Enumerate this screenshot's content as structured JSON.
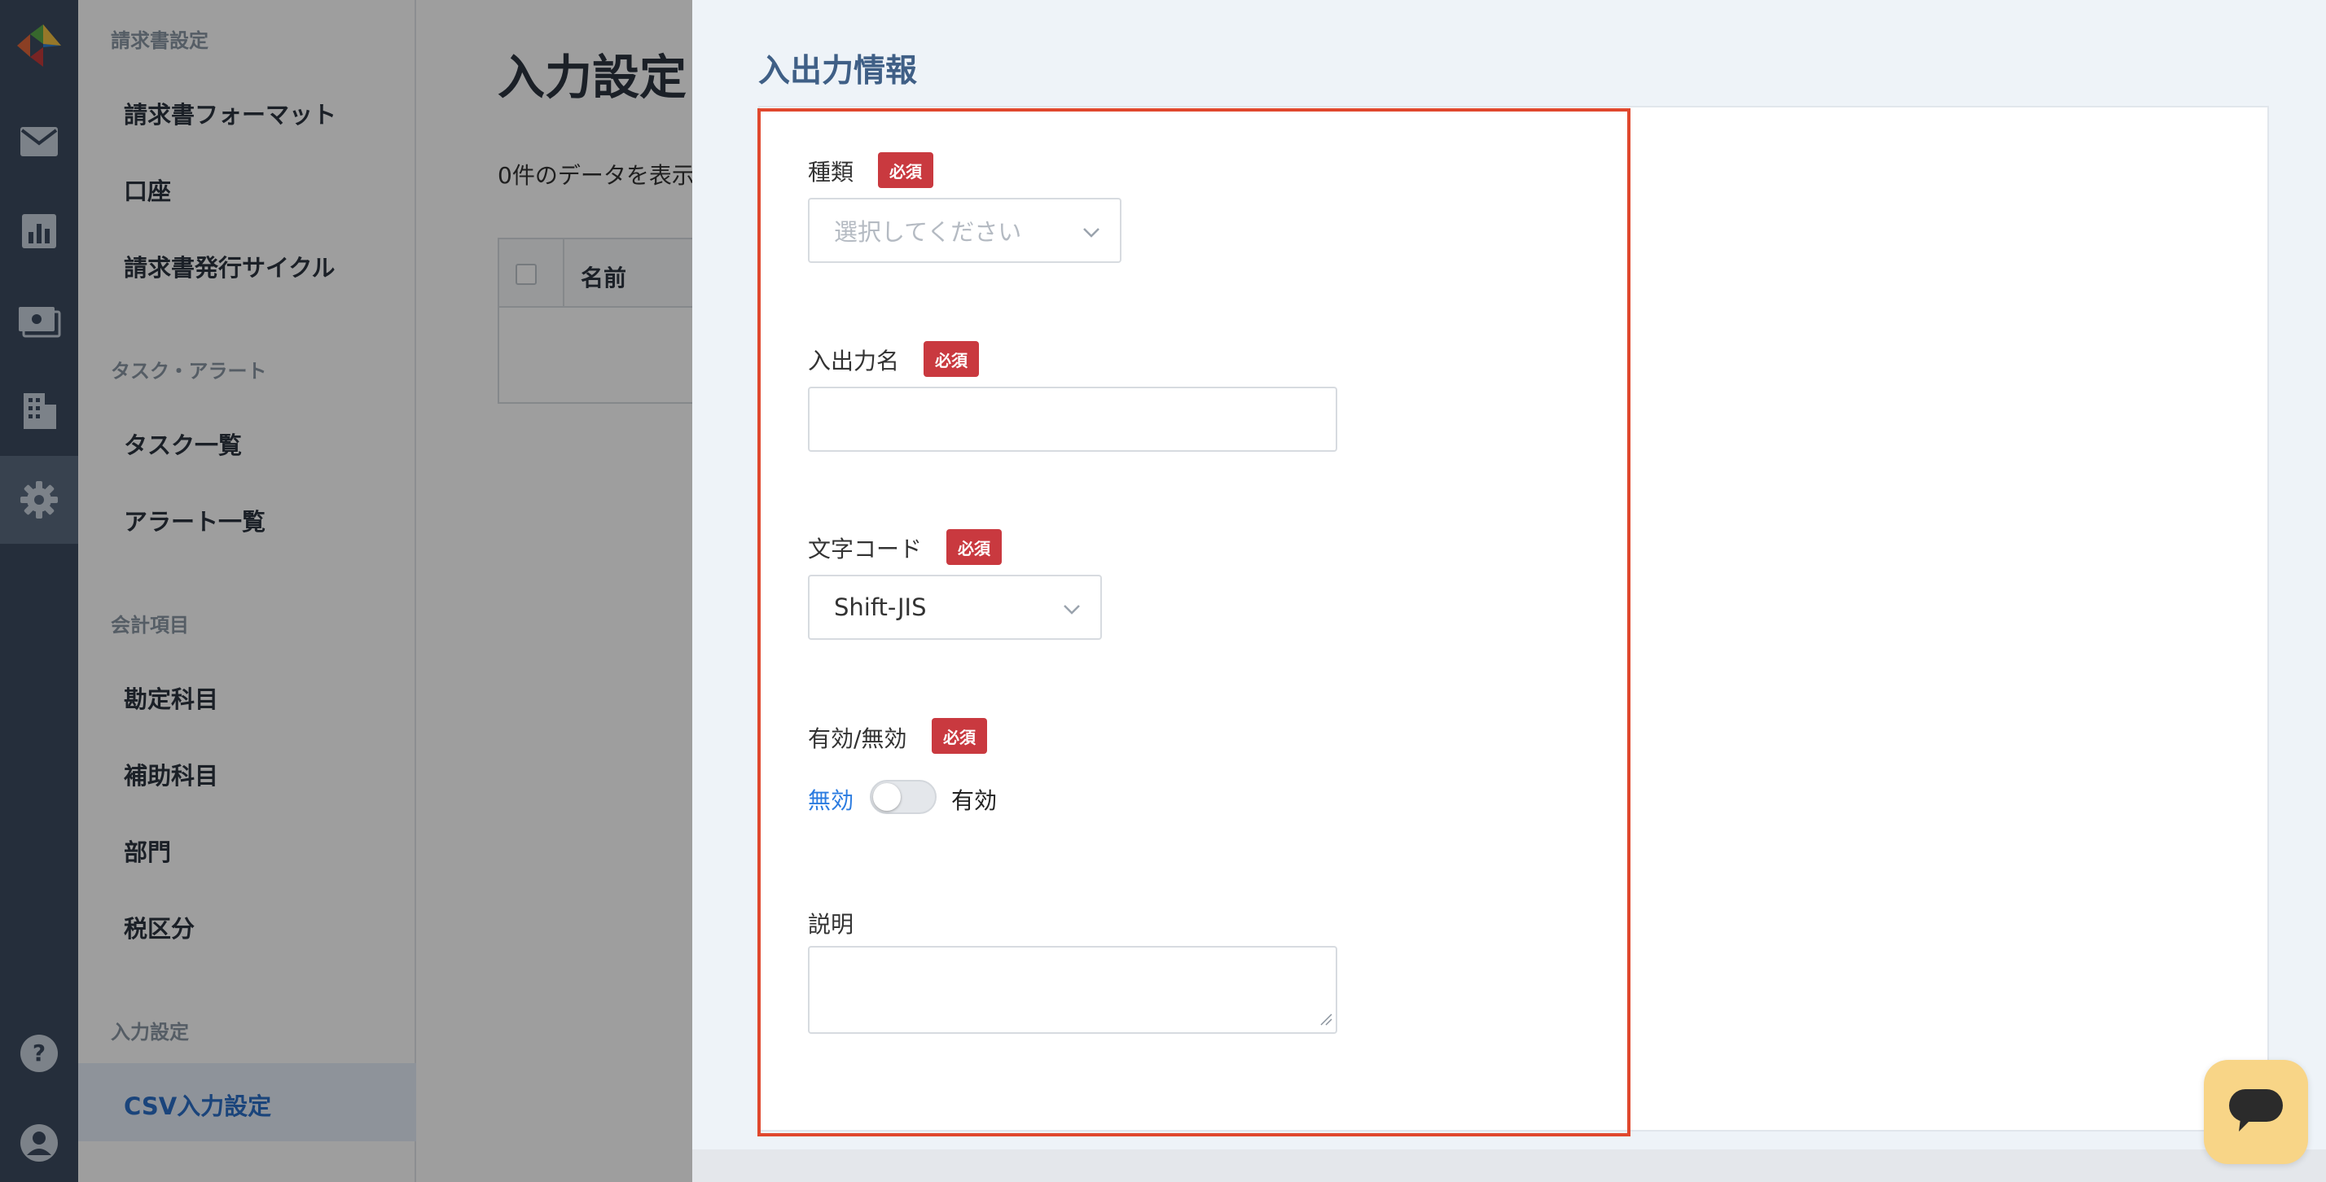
{
  "sidebar": {
    "sections": [
      {
        "title": "請求書設定",
        "items": [
          "請求書フォーマット",
          "口座",
          "請求書発行サイクル"
        ]
      },
      {
        "title": "タスク・アラート",
        "items": [
          "タスク一覧",
          "アラート一覧"
        ]
      },
      {
        "title": "会計項目",
        "items": [
          "勘定科目",
          "補助科目",
          "部門",
          "税区分"
        ]
      },
      {
        "title": "入力設定",
        "items": [
          "CSV入力設定"
        ]
      }
    ],
    "active_item": "CSV入力設定"
  },
  "main": {
    "title": "入力設定",
    "count_text": "0件のデータを表示",
    "table": {
      "columns": [
        "名前"
      ]
    }
  },
  "drawer": {
    "title": "入出力情報",
    "required_badge": "必須",
    "fields": {
      "type": {
        "label": "種類",
        "placeholder": "選択してください"
      },
      "name": {
        "label": "入出力名",
        "value": ""
      },
      "encoding": {
        "label": "文字コード",
        "value": "Shift-JIS"
      },
      "enabled": {
        "label": "有効/無効",
        "off_label": "無効",
        "on_label": "有効",
        "state": false
      },
      "description": {
        "label": "説明",
        "value": ""
      }
    }
  },
  "colors": {
    "rail": "#3c4b5f",
    "accent_blue": "#2a6fc7",
    "required_red": "#c9393f",
    "highlight_border": "#e0482e",
    "chat_button": "#f8d587"
  },
  "icons": [
    "logo-icon",
    "mail-icon",
    "chart-icon",
    "money-icon",
    "building-icon",
    "gear-icon",
    "help-icon",
    "user-icon",
    "chevron-down-icon",
    "chat-icon"
  ]
}
